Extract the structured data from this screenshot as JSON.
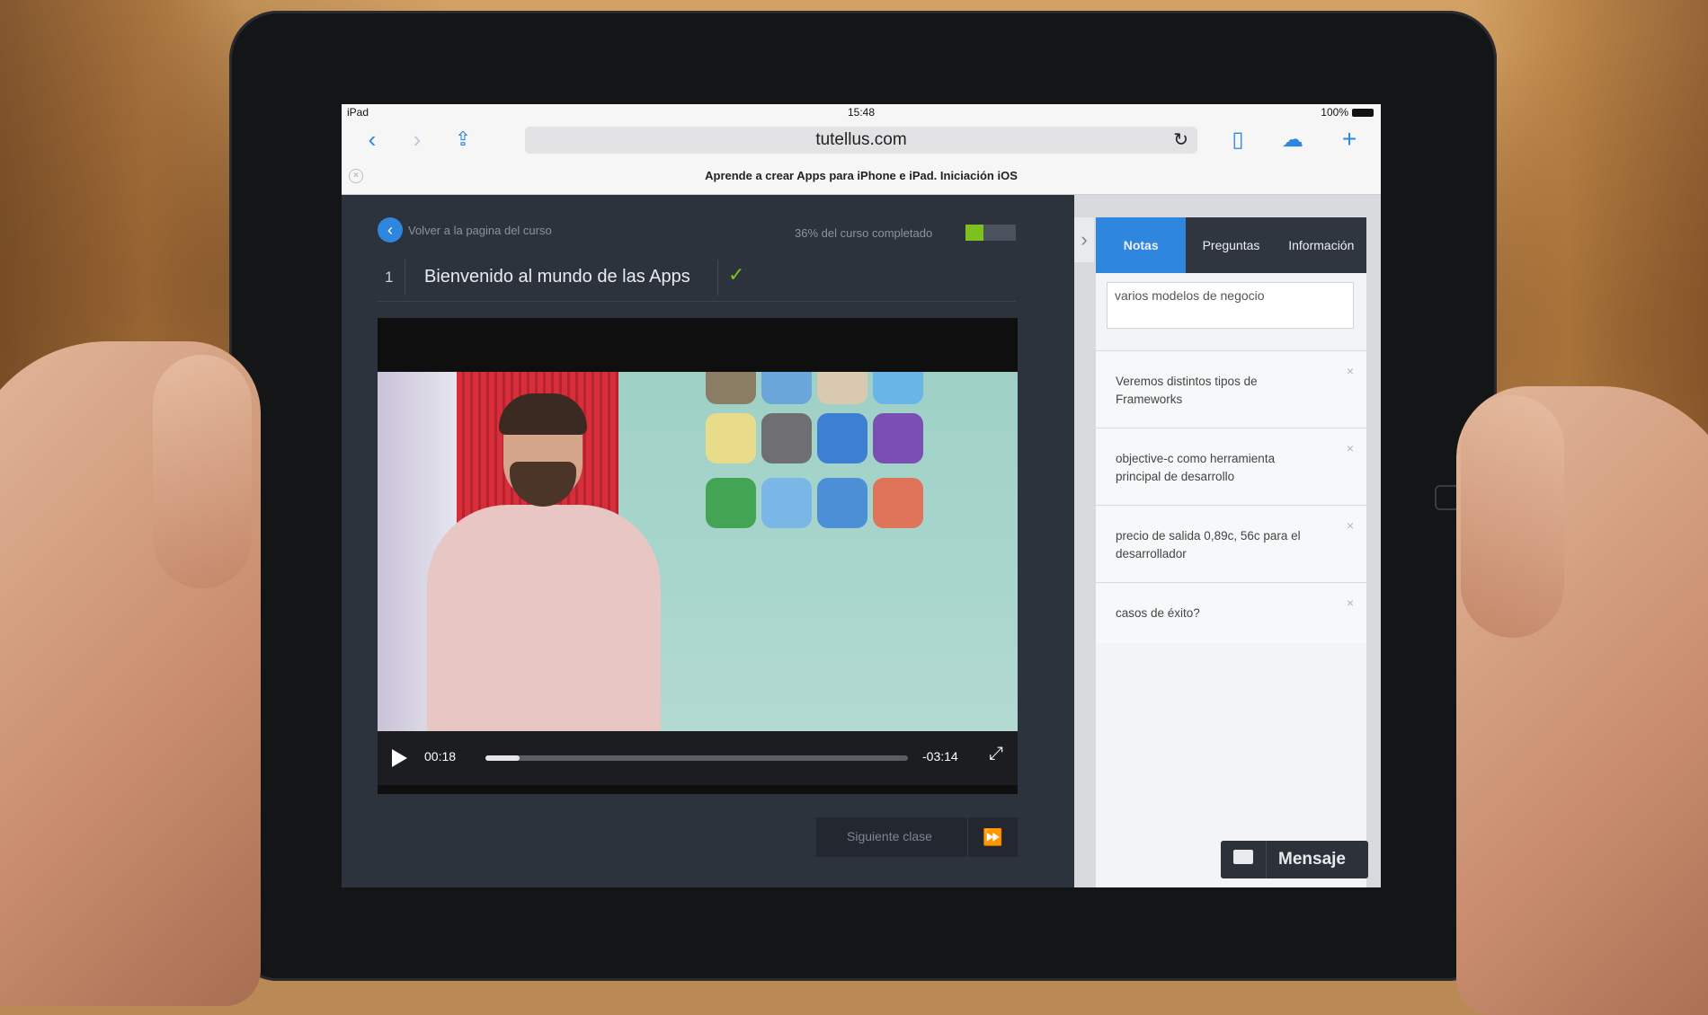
{
  "status_bar": {
    "device": "iPad",
    "time": "15:48",
    "battery": "100%"
  },
  "browser": {
    "url": "tutellus.com",
    "page_title": "Aprende a crear Apps para iPhone e iPad. Iniciación iOS",
    "icons": [
      "back-icon",
      "forward-icon",
      "share-icon",
      "reload-icon",
      "bookmarks-icon",
      "cloud-icon",
      "new-tab-icon",
      "close-tab-icon"
    ]
  },
  "course": {
    "back_label": "Volver a la pagina del curso",
    "progress_text": "36% del curso completado",
    "progress_fraction": 0.36,
    "lesson_number": "1",
    "lesson_title": "Bienvenido al mundo de las Apps",
    "lesson_check": "✓",
    "player": {
      "elapsed": "00:18",
      "remaining": "-03:14",
      "progress_fraction": 0.08
    },
    "next_label": "Siguiente clase"
  },
  "sidebar": {
    "tabs": [
      {
        "label": "Notas",
        "active": true
      },
      {
        "label": "Preguntas",
        "active": false
      },
      {
        "label": "Información",
        "active": false
      }
    ],
    "note_input_value": "varios modelos de negocio",
    "notes": [
      {
        "text": "Veremos distintos tipos de Frameworks"
      },
      {
        "text": "objective-c como herramienta principal de desarrollo"
      },
      {
        "text": "precio de salida 0,89c, 56c para el desarrollador"
      },
      {
        "text": "casos de éxito?"
      }
    ]
  },
  "message_button": {
    "label": "Mensaje"
  },
  "colors": {
    "accent": "#2e86de",
    "success": "#7cc11d",
    "panel_dark": "#2d333c"
  }
}
